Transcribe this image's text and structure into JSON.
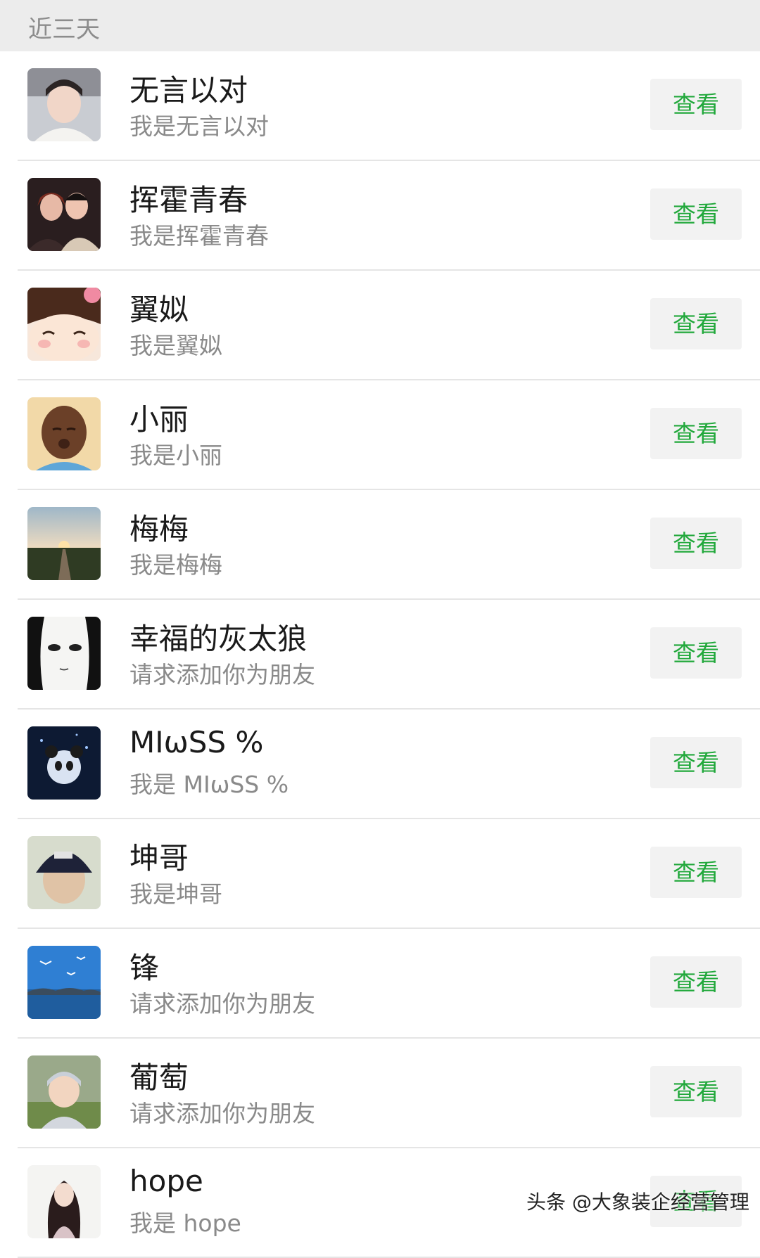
{
  "section": {
    "title": "近三天"
  },
  "view_label": "查看",
  "requests": [
    {
      "name": "无言以对",
      "message": "我是无言以对",
      "avatar": "avatar-woman-white-coat"
    },
    {
      "name": "挥霍青春",
      "message": "我是挥霍青春",
      "avatar": "avatar-couple-photo"
    },
    {
      "name": "翼姒",
      "message": "我是翼姒",
      "avatar": "avatar-cartoon-girl"
    },
    {
      "name": "小丽",
      "message": "我是小丽",
      "avatar": "avatar-man-kissing-face"
    },
    {
      "name": "梅梅",
      "message": "我是梅梅",
      "avatar": "avatar-sunset-path"
    },
    {
      "name": "幸福的灰太狼",
      "message": "请求添加你为朋友",
      "avatar": "avatar-anime-face-sketch"
    },
    {
      "name": "MIωSS %",
      "message": "我是 MIωSS %",
      "avatar": "avatar-panda-night"
    },
    {
      "name": "坤哥",
      "message": "我是坤哥",
      "avatar": "avatar-cap-back-head"
    },
    {
      "name": "锋",
      "message": "请求添加你为朋友",
      "avatar": "avatar-seagulls-lake"
    },
    {
      "name": "葡萄",
      "message": "请求添加你为朋友",
      "avatar": "avatar-baby-on-grass"
    },
    {
      "name": "hope",
      "message": "我是 hope",
      "avatar": "avatar-anime-girl"
    }
  ],
  "watermark": "头条 @大象装企经营管理",
  "colors": {
    "accent_green": "#21a83b",
    "header_bg": "#ececec",
    "button_bg": "#f2f2f2"
  }
}
